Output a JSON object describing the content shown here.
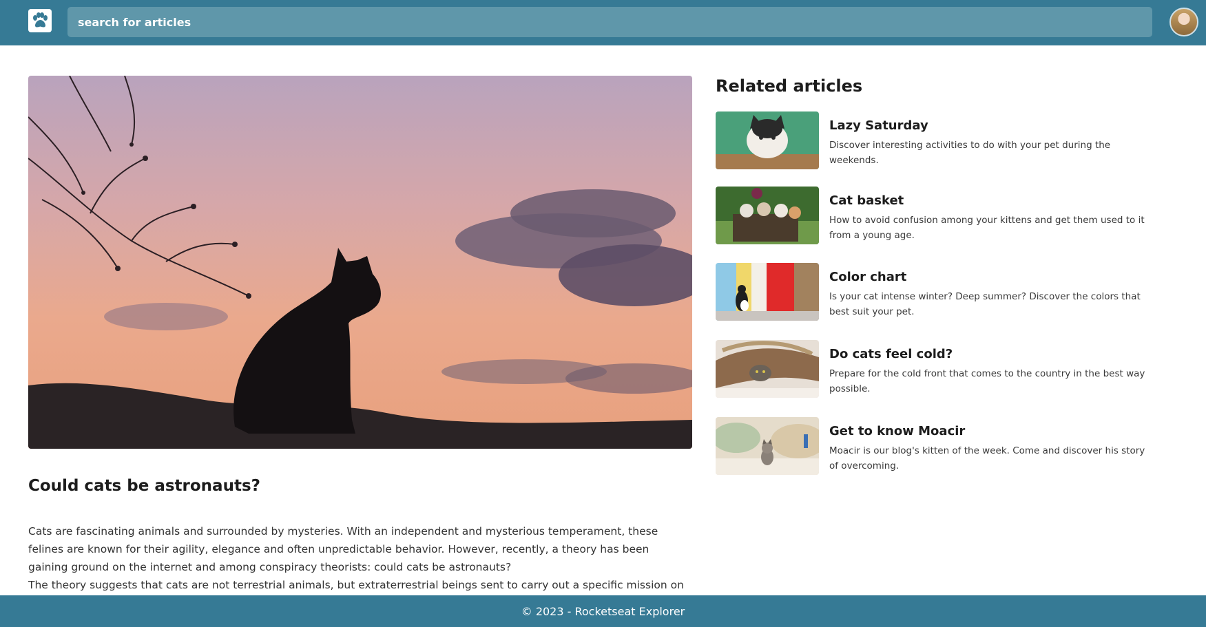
{
  "header": {
    "logo_icon": "paw-icon",
    "search_placeholder": "search for articles",
    "avatar_icon": "user-avatar"
  },
  "article": {
    "image": "cat-silhouette-sunset",
    "title": "Could cats be astronauts?",
    "paragraphs": [
      "Cats are fascinating animals and surrounded by mysteries. With an independent and mysterious temperament, these felines are known for their agility, elegance and often unpredictable behavior. However, recently, a theory has been gaining ground on the internet and among conspiracy theorists: could cats be astronauts?",
      "The theory suggests that cats are not terrestrial animals, but extraterrestrial beings sent to carry out a specific mission on our"
    ]
  },
  "sidebar": {
    "heading": "Related articles",
    "items": [
      {
        "title": "Lazy Saturday",
        "description": "Discover interesting activities to do with your pet during the weekends.",
        "thumb": "cat-on-green"
      },
      {
        "title": "Cat basket",
        "description": "How to avoid confusion among your kittens and get them used to it from a young age.",
        "thumb": "kittens-basket"
      },
      {
        "title": "Color chart",
        "description": "Is your cat intense winter? Deep summer? Discover the colors that best suit your pet.",
        "thumb": "cat-colored-wall"
      },
      {
        "title": "Do cats feel cold?",
        "description": "Prepare for the cold front that comes to the country in the best way possible.",
        "thumb": "cat-under-blanket"
      },
      {
        "title": "Get to know Moacir",
        "description": "Moacir is our blog's kitten of the week. Come and discover his story of overcoming.",
        "thumb": "kitten-on-bed"
      }
    ]
  },
  "footer": {
    "text": "© 2023 - Rocketseat Explorer"
  },
  "colors": {
    "primary": "#367a95",
    "search_bg": "#5f97aa"
  }
}
